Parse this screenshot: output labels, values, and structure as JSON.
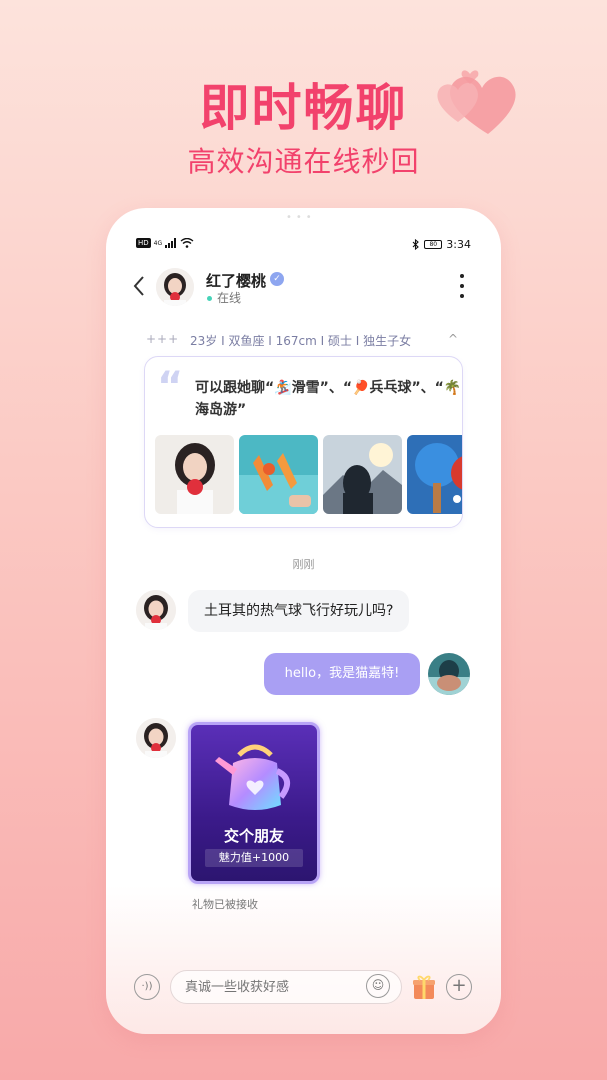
{
  "hero": {
    "title": "即时畅聊",
    "subtitle": "高效沟通在线秒回"
  },
  "status_bar": {
    "hd": "HD",
    "network": "4G",
    "battery": "80",
    "time": "3:34"
  },
  "chat_header": {
    "name": "红了樱桃",
    "online_status": "在线"
  },
  "profile": {
    "plus": "+++",
    "tags": "23岁 I 双鱼座 I 167cm I 硕士 I 独生子女",
    "chevron": "^"
  },
  "interest_card": {
    "text": "可以跟她聊“🏂滑雪”、“🏓兵乓球”、“🌴海岛游”",
    "photos": [
      "portrait-photo",
      "drinks-photo",
      "mountain-photo",
      "pingpong-photo"
    ]
  },
  "messages": {
    "time_separator": "刚刚",
    "incoming_text": "土耳其的热气球飞行好玩儿吗?",
    "outgoing_text": "hello，我是猫嘉特!",
    "gift_name": "交个朋友",
    "gift_value": "魅力值+1000",
    "gift_status": "礼物已被接收"
  },
  "input_bar": {
    "placeholder": "真诚一些收获好感"
  },
  "colors": {
    "accent": "#f2426c",
    "outgoing_bubble": "#a99ff3",
    "gift_bg": "#4a23a0"
  }
}
